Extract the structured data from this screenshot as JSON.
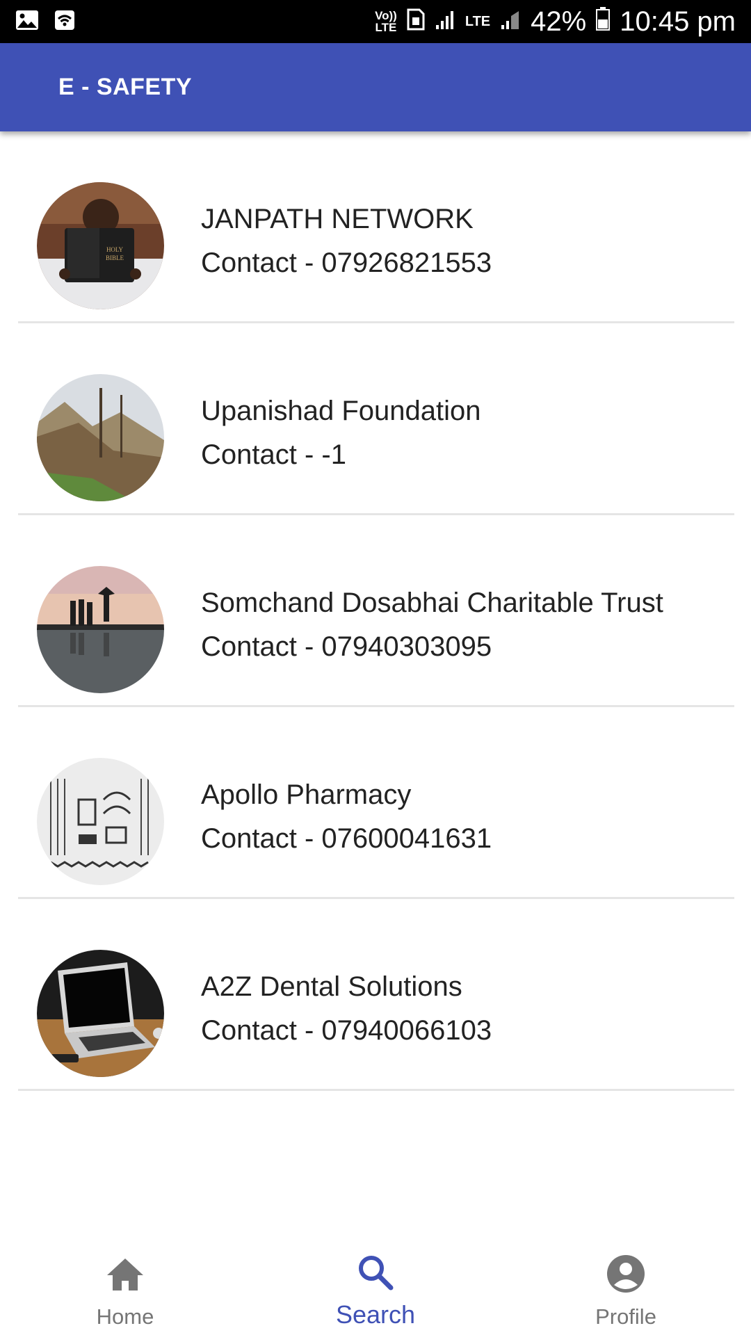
{
  "status_bar": {
    "volte_top": "Vo))",
    "volte_bottom": "LTE",
    "network_type": "LTE",
    "battery": "42%",
    "time": "10:45 pm"
  },
  "app_bar": {
    "title": "E - SAFETY"
  },
  "list": {
    "items": [
      {
        "name": "JANPATH NETWORK",
        "contact": "Contact - 07926821553"
      },
      {
        "name": "Upanishad Foundation",
        "contact": "Contact - -1"
      },
      {
        "name": "Somchand Dosabhai Charitable Trust",
        "contact": "Contact - 07940303095"
      },
      {
        "name": "Apollo Pharmacy",
        "contact": "Contact - 07600041631"
      },
      {
        "name": "A2Z Dental Solutions",
        "contact": "Contact - 07940066103"
      }
    ]
  },
  "bottom_nav": {
    "home_label": "Home",
    "search_label": "Search",
    "profile_label": "Profile",
    "active": "search"
  },
  "colors": {
    "primary": "#3f51b5",
    "inactive": "#757575"
  }
}
